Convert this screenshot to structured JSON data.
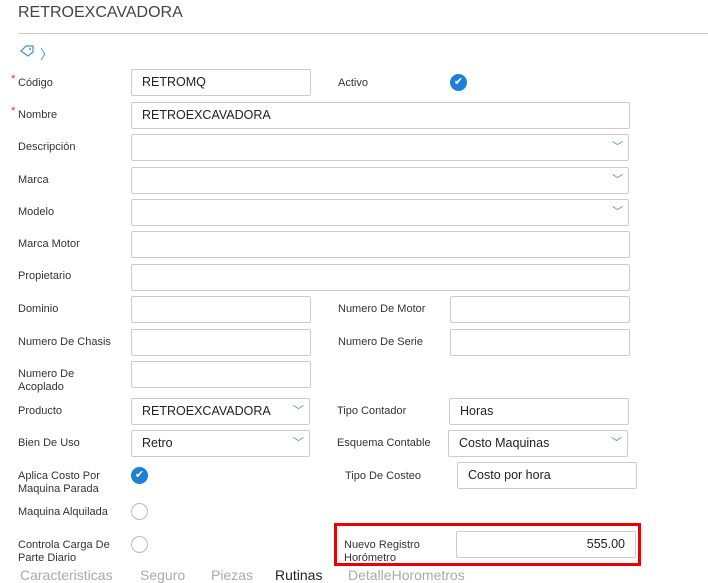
{
  "title": "RETROEXCAVADORA",
  "fields": {
    "codigo": {
      "label": "Código",
      "value": "RETROMQ"
    },
    "activo": {
      "label": "Activo",
      "checked": true
    },
    "nombre": {
      "label": "Nombre",
      "value": "RETROEXCAVADORA"
    },
    "descripcion": {
      "label": "Descripción",
      "value": ""
    },
    "marca": {
      "label": "Marca",
      "value": ""
    },
    "modelo": {
      "label": "Modelo",
      "value": ""
    },
    "marca_motor": {
      "label": "Marca Motor",
      "value": ""
    },
    "propietario": {
      "label": "Propietario",
      "value": ""
    },
    "dominio": {
      "label": "Dominio",
      "value": ""
    },
    "numero_motor": {
      "label": "Numero De Motor",
      "value": ""
    },
    "numero_chasis": {
      "label": "Numero De Chasis",
      "value": ""
    },
    "numero_serie": {
      "label": "Numero De Serie",
      "value": ""
    },
    "numero_acoplado": {
      "label": "Numero De Acoplado",
      "value": ""
    },
    "producto": {
      "label": "Producto",
      "value": "RETROEXCAVADORA"
    },
    "tipo_contador": {
      "label": "Tipo Contador",
      "value": "Horas"
    },
    "bien_uso": {
      "label": "Bien De Uso",
      "value": "Retro"
    },
    "esquema_contable": {
      "label": "Esquema Contable",
      "value": "Costo Maquinas"
    },
    "aplica_costo": {
      "label": "Aplica Costo Por Maquina Parada",
      "checked": true
    },
    "tipo_costeo": {
      "label": "Tipo De Costeo",
      "value": "Costo por hora"
    },
    "maquina_alquilada": {
      "label": "Maquina Alquilada",
      "checked": false
    },
    "controla_carga": {
      "label": "Controla Carga De Parte Diario",
      "checked": false
    },
    "nuevo_registro": {
      "label": "Nuevo Registro Horómetro",
      "value": "555.00"
    }
  },
  "tabs": [
    "Caracteristicas",
    "Seguro",
    "Piezas",
    "Rutinas",
    "DetalleHorometros"
  ],
  "active_tab": "Rutinas",
  "required_mark": "*"
}
